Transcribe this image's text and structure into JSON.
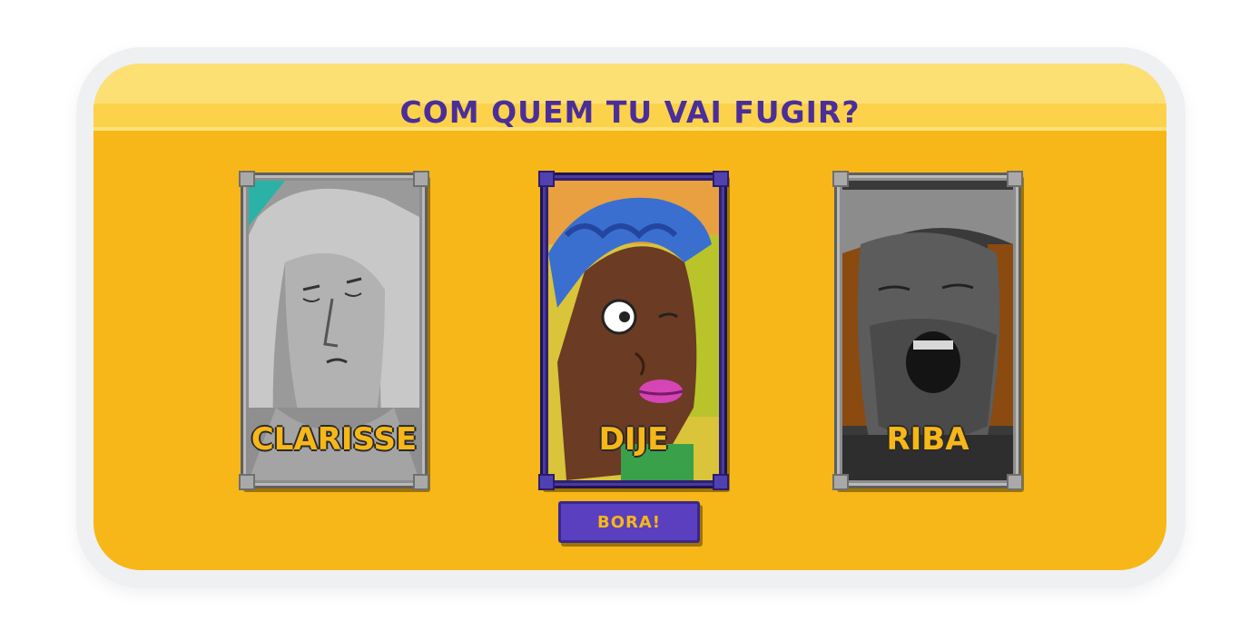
{
  "title": "COM QUEM TU VAI FUGIR?",
  "characters": [
    {
      "name": "CLARISSE",
      "selected": false,
      "style": "grayscale"
    },
    {
      "name": "DIJE",
      "selected": true,
      "style": "color"
    },
    {
      "name": "RIBA",
      "selected": false,
      "style": "grayscale"
    }
  ],
  "confirm_button": {
    "label": "BORA!"
  },
  "colors": {
    "background": "#f7b718",
    "title": "#4a2e9a",
    "button": "#5a3fbf",
    "name_text": "#f7b718"
  }
}
